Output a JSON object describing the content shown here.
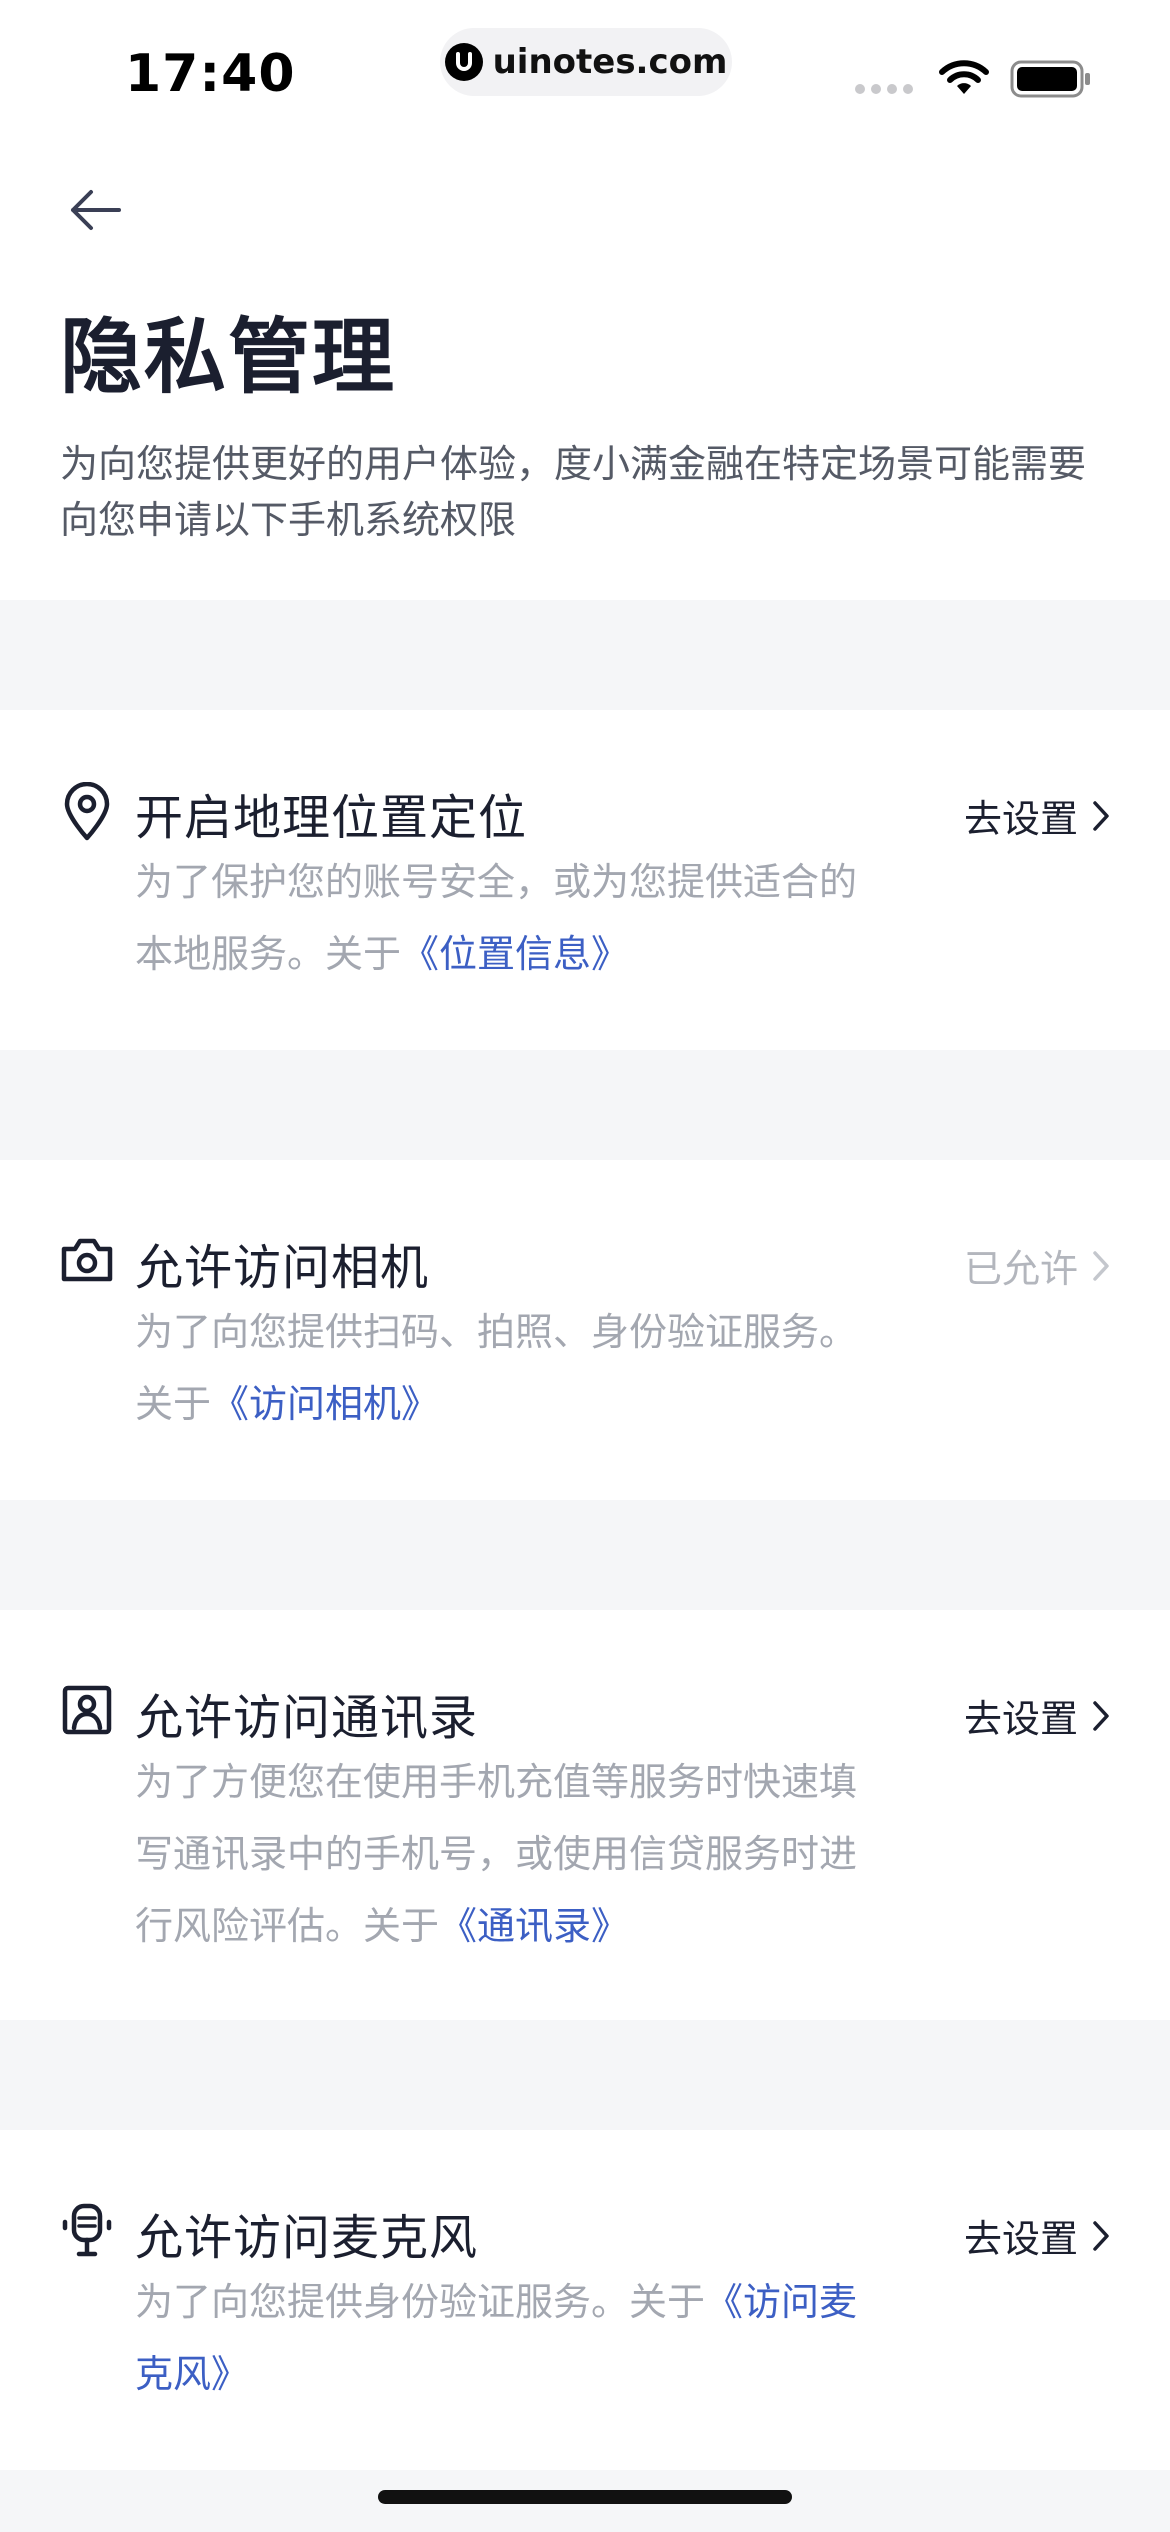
{
  "status_bar": {
    "time": "17:40",
    "url": "uinotes.com"
  },
  "header": {
    "title": "隐私管理",
    "description": "为向您提供更好的用户体验，度小满金融在特定场景可能需要向您申请以下手机系统权限"
  },
  "permissions": [
    {
      "icon": "location-pin-icon",
      "title": "开启地理位置定位",
      "desc": "为了保护您的账号安全，或为您提供适合的本地服务。关于",
      "link": "《位置信息》",
      "action": "去设置",
      "status": "not-set"
    },
    {
      "icon": "camera-icon",
      "title": "允许访问相机",
      "desc": "为了向您提供扫码、拍照、身份验证服务。关于",
      "link": "《访问相机》",
      "action": "已允许",
      "status": "allowed"
    },
    {
      "icon": "contacts-icon",
      "title": "允许访问通讯录",
      "desc": "为了方便您在使用手机充值等服务时快速填写通讯录中的手机号，或使用信贷服务时进行风险评估。关于",
      "link": "《通讯录》",
      "action": "去设置",
      "status": "not-set"
    },
    {
      "icon": "microphone-icon",
      "title": "允许访问麦克风",
      "desc": "为了向您提供身份验证服务。关于",
      "link": "《访问麦克风》",
      "action": "去设置",
      "status": "not-set"
    }
  ],
  "colors": {
    "link": "#3c5fc4",
    "section_gap": "#f5f6f8",
    "title": "#1b1f2f",
    "muted": "#a3a7b0"
  }
}
